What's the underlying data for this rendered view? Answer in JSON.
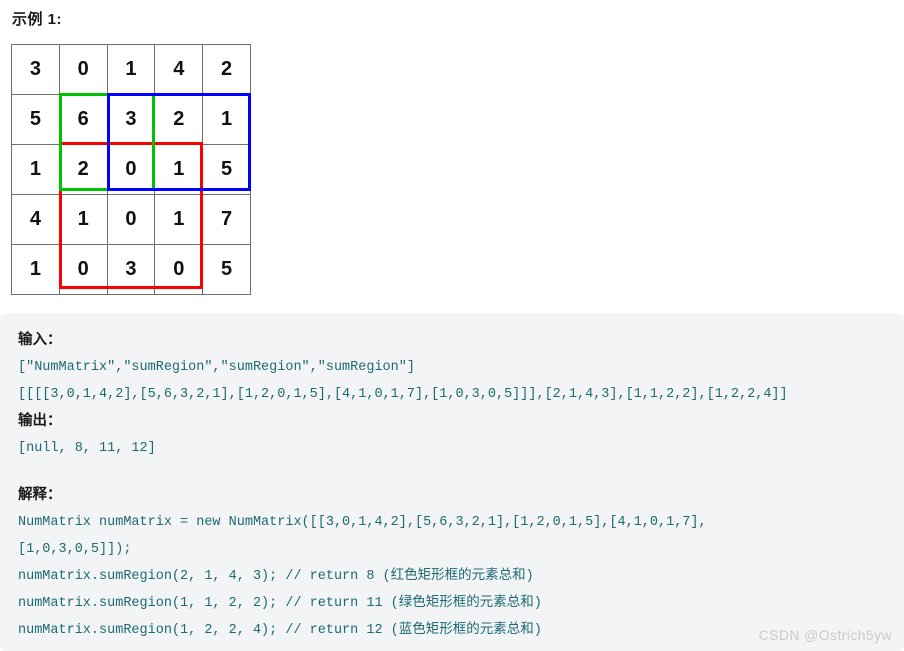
{
  "heading": "示例 1:",
  "matrix": {
    "rows": [
      [
        "3",
        "0",
        "1",
        "4",
        "2"
      ],
      [
        "5",
        "6",
        "3",
        "2",
        "1"
      ],
      [
        "1",
        "2",
        "0",
        "1",
        "5"
      ],
      [
        "4",
        "1",
        "0",
        "1",
        "7"
      ],
      [
        "1",
        "0",
        "3",
        "0",
        "5"
      ]
    ]
  },
  "highlights": {
    "red": {
      "color": "#ff0000",
      "row_start": 2,
      "row_end": 4,
      "col_start": 1,
      "col_end": 3,
      "label": "红色矩形框"
    },
    "green": {
      "color": "#00c400",
      "row_start": 1,
      "row_end": 2,
      "col_start": 1,
      "col_end": 2,
      "label": "绿色矩形框"
    },
    "blue": {
      "color": "#0000ff",
      "row_start": 1,
      "row_end": 2,
      "col_start": 2,
      "col_end": 4,
      "label": "蓝色矩形框"
    }
  },
  "panel": {
    "input_label": "输入：",
    "input_line1": "[\"NumMatrix\",\"sumRegion\",\"sumRegion\",\"sumRegion\"]",
    "input_line2": "[[[[3,0,1,4,2],[5,6,3,2,1],[1,2,0,1,5],[4,1,0,1,7],[1,0,3,0,5]]],[2,1,4,3],[1,1,2,2],[1,2,2,4]]",
    "output_label": "输出：",
    "output_line1": "[null, 8, 11, 12]",
    "explain_label": "解释：",
    "explain_line1": "NumMatrix numMatrix = new NumMatrix([[3,0,1,4,2],[5,6,3,2,1],[1,2,0,1,5],[4,1,0,1,7],",
    "explain_line2": "[1,0,3,0,5]]);",
    "explain_line3": "numMatrix.sumRegion(2, 1, 4, 3); // return 8 (红色矩形框的元素总和)",
    "explain_line4": "numMatrix.sumRegion(1, 1, 2, 2); // return 11 (绿色矩形框的元素总和)",
    "explain_line5": "numMatrix.sumRegion(1, 2, 2, 4); // return 12 (蓝色矩形框的元素总和)"
  },
  "watermark": "CSDN @Ostrich5yw"
}
